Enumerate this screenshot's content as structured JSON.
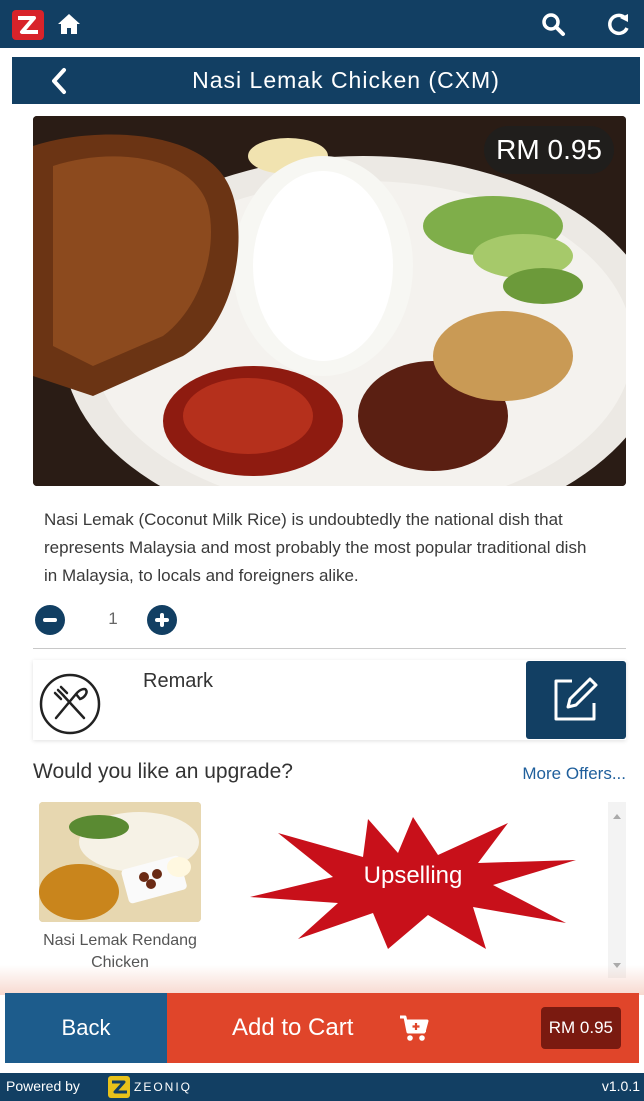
{
  "header": {
    "logo_icon": "brand-logo-icon",
    "home_icon": "home-icon",
    "search_icon": "search-icon",
    "refresh_icon": "refresh-icon"
  },
  "product": {
    "title": "Nasi Lemak Chicken (CXM)",
    "price": "RM 0.95",
    "description": "Nasi Lemak (Coconut Milk Rice) is undoubtedly the national dish that represents Malaysia and most probably the most popular traditional dish in Malaysia, to locals and foreigners alike.",
    "quantity": "1"
  },
  "remark": {
    "label": "Remark",
    "icon": "cutlery-icon",
    "edit_icon": "edit-icon"
  },
  "upgrade": {
    "title": "Would you like an upgrade?",
    "more_offers": "More Offers...",
    "items": [
      {
        "name": "Nasi Lemak Rendang Chicken"
      }
    ],
    "annotation": "Upselling"
  },
  "actions": {
    "back": "Back",
    "add_to_cart": "Add to Cart",
    "total": "RM 0.95"
  },
  "footer": {
    "powered_by": "Powered by",
    "brand": "ZEONIQ",
    "version": "v1.0.1"
  },
  "colors": {
    "primary": "#123f63",
    "back_button": "#1d5c8c",
    "cart": "#e0452a",
    "total_badge": "#7a1a10",
    "burst": "#c8101a"
  }
}
